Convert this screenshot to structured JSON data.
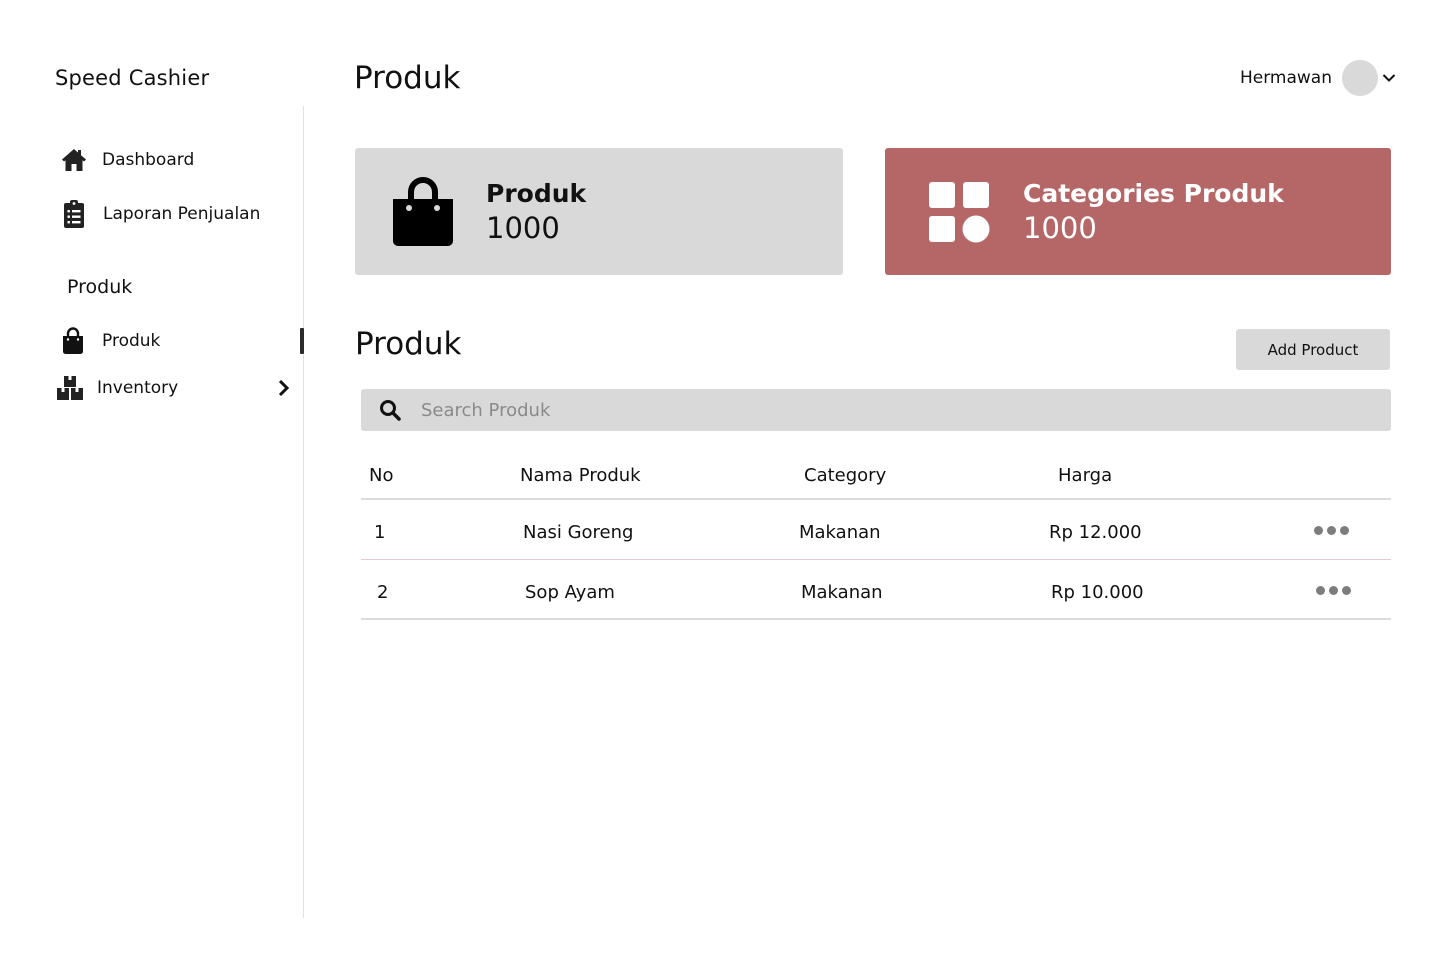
{
  "app": {
    "title": "Speed Cashier"
  },
  "sidebar": {
    "items": [
      {
        "label": "Dashboard",
        "icon": "home-icon"
      },
      {
        "label": "Laporan Penjualan",
        "icon": "clipboard-list-icon"
      }
    ],
    "section_label": "Produk",
    "section_items": [
      {
        "label": "Produk",
        "icon": "shopping-bag-icon",
        "active": true
      },
      {
        "label": "Inventory",
        "icon": "boxes-icon",
        "has_submenu": true
      }
    ]
  },
  "header": {
    "page_title": "Produk",
    "user_name": "Hermawan"
  },
  "stats": [
    {
      "label": "Produk",
      "value": "1000",
      "icon": "shopping-bag-icon",
      "bg_color": "#d9d9d9"
    },
    {
      "label": "Categories Produk",
      "value": "1000",
      "icon": "category-grid-icon",
      "bg_color": "#b56767"
    }
  ],
  "section": {
    "title": "Produk",
    "add_button_label": "Add Product"
  },
  "search": {
    "placeholder": "Search Produk",
    "value": ""
  },
  "table": {
    "columns": [
      "No",
      "Nama Produk",
      "Category",
      "Harga"
    ],
    "rows": [
      {
        "no": "1",
        "name": "Nasi Goreng",
        "category": "Makanan",
        "price": "Rp 12.000"
      },
      {
        "no": "2",
        "name": "Sop Ayam",
        "category": "Makanan",
        "price": "Rp 10.000"
      }
    ]
  }
}
